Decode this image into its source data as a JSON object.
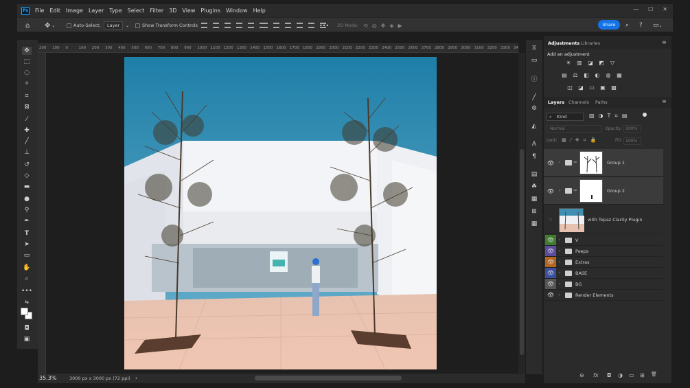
{
  "menubar": {
    "logo": "Ps",
    "items": [
      "File",
      "Edit",
      "Image",
      "Layer",
      "Type",
      "Select",
      "Filter",
      "3D",
      "View",
      "Plugins",
      "Window",
      "Help"
    ],
    "window_controls": [
      "—",
      "☐",
      "✕"
    ]
  },
  "options": {
    "auto_select_label": "Auto-Select:",
    "auto_select_value": "Layer",
    "show_transform_label": "Show Transform Controls",
    "mode_3d_label": "3D Mode:",
    "more_label": "•••",
    "share_label": "Share"
  },
  "ruler": {
    "ticks": [
      "200",
      "100",
      "0",
      "100",
      "200",
      "300",
      "400",
      "500",
      "600",
      "700",
      "800",
      "900",
      "1000",
      "1100",
      "1200",
      "1300",
      "1400",
      "1500",
      "1600",
      "1700",
      "1800",
      "1900",
      "2000",
      "2100",
      "2200",
      "2300",
      "2400",
      "2500",
      "2600",
      "2700",
      "2800",
      "2900",
      "3000",
      "3100",
      "3200",
      "3300",
      "3400",
      "3500",
      "3600"
    ]
  },
  "status": {
    "zoom": "35.3%",
    "dimensions": "3000 px x 3000 px (72 ppi)",
    "arrow": "›"
  },
  "adjustments": {
    "tab_adjustments": "Adjustments",
    "tab_libraries": "Libraries",
    "add_label": "Add an adjustment",
    "menu_icon": "≡",
    "row1": [
      "☀",
      "▥",
      "◪",
      "◩",
      "▽"
    ],
    "row2": [
      "▤",
      "⚖",
      "◧",
      "◐",
      "◍",
      "▦"
    ],
    "row3": [
      "◫",
      "◪",
      "▭",
      "▣",
      "▩"
    ]
  },
  "layers": {
    "tab_layers": "Layers",
    "tab_channels": "Channels",
    "tab_paths": "Paths",
    "filter_label": "Kind",
    "blend_mode": "Normal",
    "opacity_label": "Opacity:",
    "opacity_value": "100%",
    "lock_label": "Lock:",
    "fill_label": "Fill:",
    "fill_value": "100%",
    "items": [
      {
        "name": "Group 1",
        "visible": true
      },
      {
        "name": "Group 2",
        "visible": true
      },
      {
        "name": "with Topaz Clarity Plugin",
        "visible": false
      },
      {
        "name": "V",
        "visible": true,
        "color": "#3e7d2f"
      },
      {
        "name": "Peeps",
        "visible": true,
        "color": "#5b4c9d"
      },
      {
        "name": "Extras",
        "visible": true,
        "color": "#b5651d"
      },
      {
        "name": "BASE",
        "visible": true,
        "color": "#3a4f9e"
      },
      {
        "name": "BG",
        "visible": true,
        "color": "#555555"
      },
      {
        "name": "Render Elements",
        "visible": true
      }
    ]
  },
  "footer_icons": [
    "⊖",
    "fx",
    "◘",
    "◑",
    "▭",
    "⊞",
    "🗑"
  ]
}
